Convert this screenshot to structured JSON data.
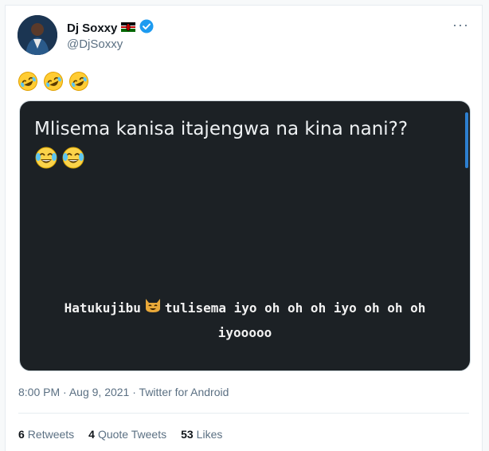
{
  "user": {
    "display_name": "Dj Soxxy",
    "handle": "@DjSoxxy",
    "verified": true,
    "flag": "kenya-flag-icon"
  },
  "tweet": {
    "text_emojis": [
      "rolling-on-floor-laughing-icon",
      "rolling-on-floor-laughing-icon",
      "rolling-on-floor-laughing-icon"
    ]
  },
  "media": {
    "line1": "Mlisema kanisa itajengwa na kina nani??",
    "caption_part1": "Hatukujibu",
    "caption_part2": "tulisema iyo oh oh oh iyo oh oh oh",
    "caption_line2": "iyooooo"
  },
  "meta": {
    "time": "8:00 PM",
    "date": "Aug 9, 2021",
    "source": "Twitter for Android",
    "dot": "·"
  },
  "stats": {
    "retweets_count": "6",
    "retweets_label": "Retweets",
    "quotes_count": "4",
    "quotes_label": "Quote Tweets",
    "likes_count": "53",
    "likes_label": "Likes"
  },
  "more_glyph": "···",
  "colors": {
    "verified_blue": "#1d9bf0",
    "media_bg": "#1c2125",
    "secondary_text": "#5b7083"
  }
}
